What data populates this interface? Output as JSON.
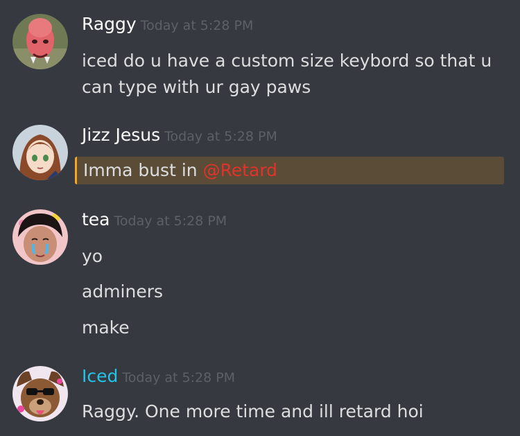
{
  "messages": [
    {
      "username": "Raggy",
      "timestamp": "Today at 5:28 PM",
      "username_color": "#ffffff",
      "lines": [
        "iced do u have a custom size keybord so that u",
        "can type with ur gay paws"
      ]
    },
    {
      "username": "Jizz Jesus",
      "timestamp": "Today at 5:28 PM",
      "username_color": "#ffffff",
      "text": "Imma bust in ",
      "mention": "@Retard"
    },
    {
      "username": "tea",
      "timestamp": "Today at 5:28 PM",
      "username_color": "#ffffff",
      "lines": [
        "yo",
        "adminers",
        "make"
      ]
    },
    {
      "username": "Iced",
      "timestamp": "Today at 5:28 PM",
      "username_color": "#22c4e8",
      "lines": [
        "Raggy. One more time and ill retard hoi"
      ]
    }
  ],
  "colors": {
    "background": "#36393f",
    "text": "#dcddde",
    "timestamp": "#5d6166",
    "mention_bg": "#5a4c37",
    "mention_border": "#faa61a",
    "mention_text": "#e0332c"
  }
}
